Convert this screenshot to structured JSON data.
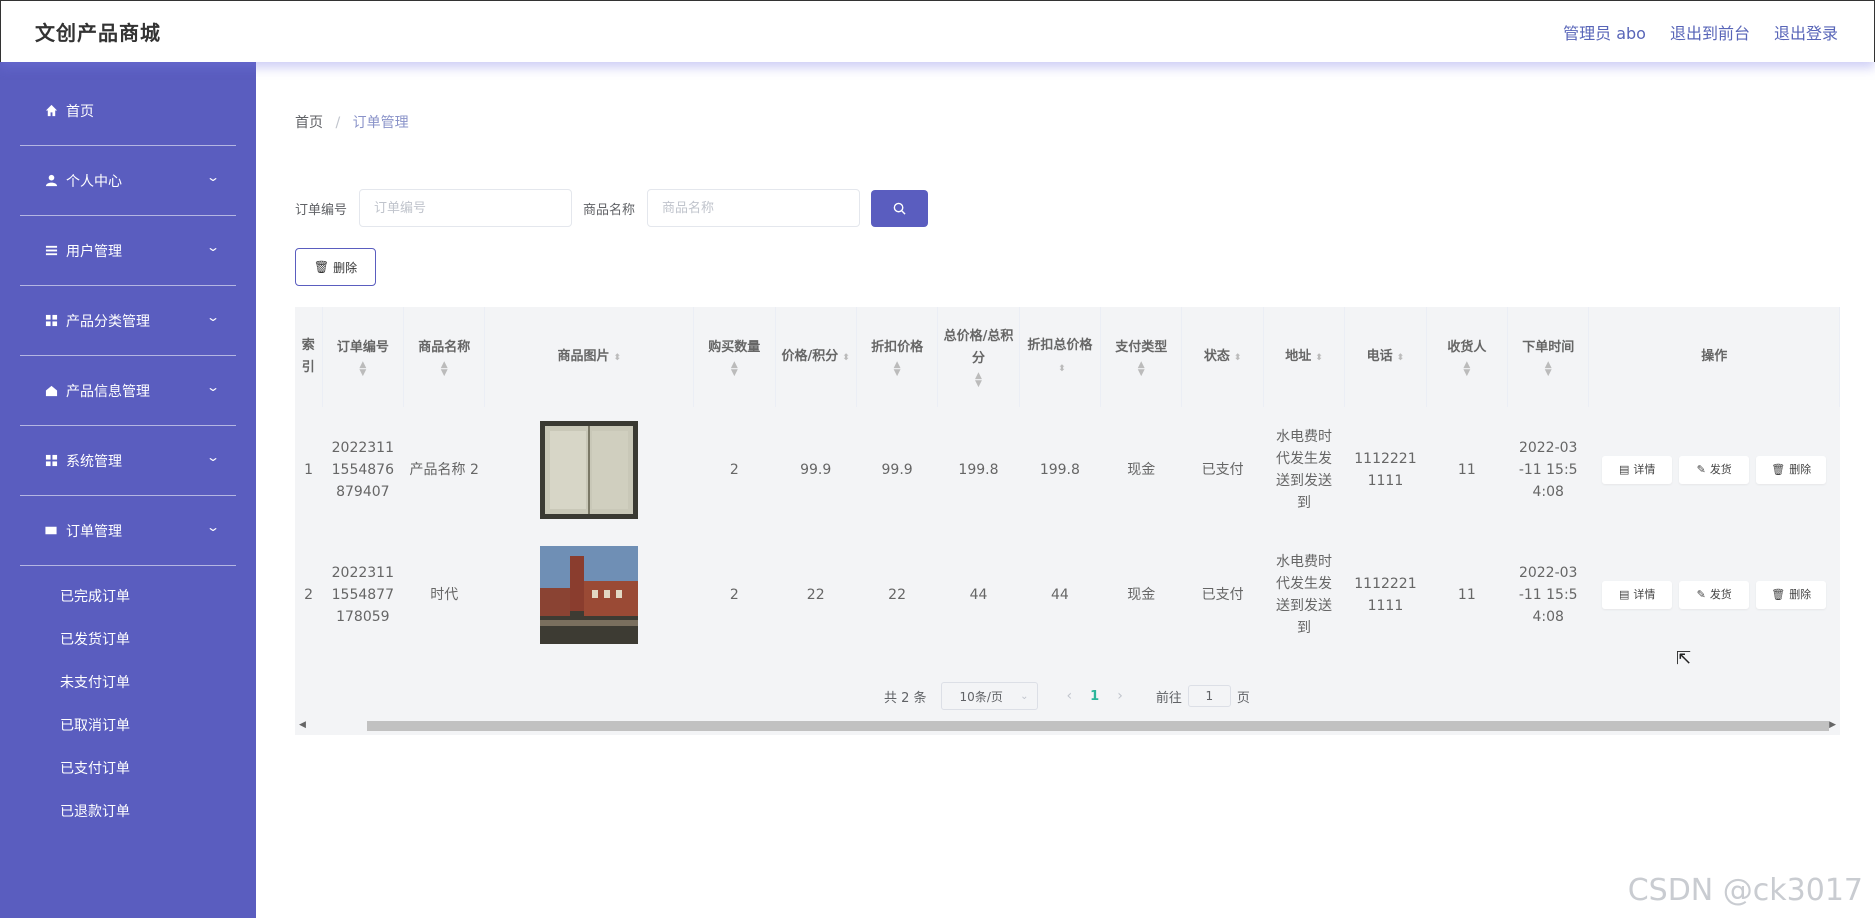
{
  "app": {
    "title": "文创产品商城"
  },
  "header": {
    "admin_label": "管理员 abo",
    "to_front": "退出到前台",
    "logout": "退出登录"
  },
  "sidebar": {
    "items": [
      {
        "label": "首页",
        "icon": "home-icon"
      },
      {
        "label": "个人中心",
        "icon": "user-icon"
      },
      {
        "label": "用户管理",
        "icon": "list-icon"
      },
      {
        "label": "产品分类管理",
        "icon": "grid-icon"
      },
      {
        "label": "产品信息管理",
        "icon": "home-edit-icon"
      },
      {
        "label": "系统管理",
        "icon": "grid-icon"
      },
      {
        "label": "订单管理",
        "icon": "order-icon"
      }
    ],
    "order_sub": [
      "已完成订单",
      "已发货订单",
      "未支付订单",
      "已取消订单",
      "已支付订单",
      "已退款订单"
    ]
  },
  "breadcrumb": {
    "home": "首页",
    "separator": "/",
    "current": "订单管理"
  },
  "search": {
    "order_no_label": "订单编号",
    "order_no_placeholder": "订单编号",
    "product_label": "商品名称",
    "product_placeholder": "商品名称"
  },
  "toolbar": {
    "delete_label": "删除"
  },
  "table": {
    "headers": {
      "index": "索引",
      "order_no": "订单编号",
      "product_name": "商品名称",
      "product_image": "商品图片",
      "quantity": "购买数量",
      "price": "价格/积分",
      "discount_price": "折扣价格",
      "total": "总价格/总积分",
      "discount_total": "折扣总价格",
      "pay_type": "支付类型",
      "status": "状态",
      "address": "地址",
      "phone": "电话",
      "receiver": "收货人",
      "order_time": "下单时间",
      "actions": "操作"
    },
    "rows": [
      {
        "index": "1",
        "order_no": "2022311 1554876 879407",
        "product_name": "产品名称 2",
        "image": "book",
        "quantity": "2",
        "price": "99.9",
        "discount_price": "99.9",
        "total": "199.8",
        "discount_total": "199.8",
        "pay_type": "现金",
        "status": "已支付",
        "address": "水电费时 代发生发 送到发送 到",
        "phone": "1112221 1111",
        "receiver": "11",
        "order_time": "2022-03 -11 15:5 4:08"
      },
      {
        "index": "2",
        "order_no": "2022311 1554877 178059",
        "product_name": "时代",
        "image": "building",
        "quantity": "2",
        "price": "22",
        "discount_price": "22",
        "total": "44",
        "discount_total": "44",
        "pay_type": "现金",
        "status": "已支付",
        "address": "水电费时 代发生发 送到发送 到",
        "phone": "1112221 1111",
        "receiver": "11",
        "order_time": "2022-03 -11 15:5 4:08"
      }
    ],
    "actions": {
      "detail": "详情",
      "ship": "发货",
      "delete": "删除"
    }
  },
  "pagination": {
    "total": "共 2 条",
    "page_size": "10条/页",
    "current_page": "1",
    "goto_label": "前往",
    "goto_value": "1",
    "page_unit": "页"
  },
  "watermark": "CSDN @ck3017",
  "colors": {
    "primary": "#5a5dbf",
    "link": "#5865b8",
    "active_page": "#2bb59a"
  }
}
